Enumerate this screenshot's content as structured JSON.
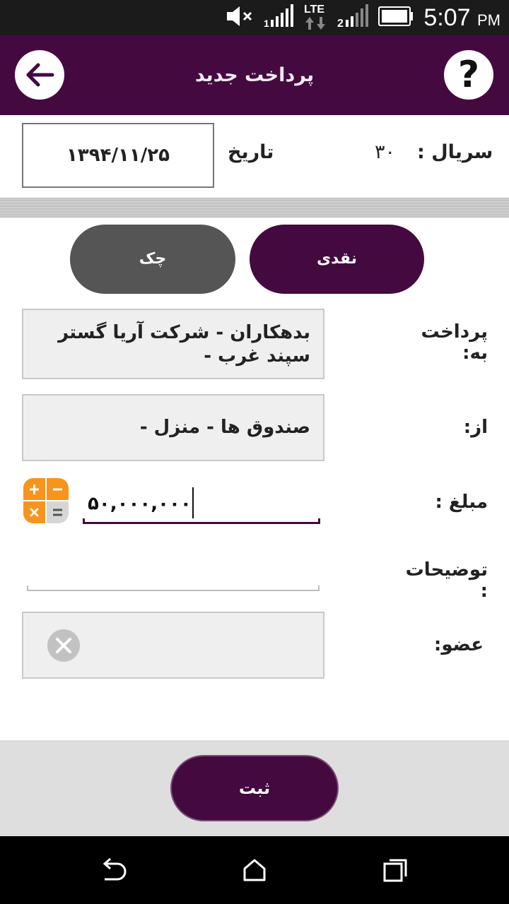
{
  "status_bar": {
    "time": "5:07",
    "ampm": "PM",
    "network": "LTE"
  },
  "app_bar": {
    "title": "پرداخت جدید",
    "help_label": "?"
  },
  "header": {
    "serial_label": "سریال :",
    "serial_value": "۳۰",
    "date_label": "تاریخ",
    "date_value": "۱۳۹۴/۱۱/۲۵"
  },
  "payment_type": {
    "cash_label": "نقدی",
    "cheque_label": "چک",
    "selected": "نقدی"
  },
  "form": {
    "to_label": "پرداخت به:",
    "to_value": "بدهکاران - شرکت آریا گستر سپند غرب -",
    "from_label": "از:",
    "from_value": "صندوق ها - منزل -",
    "amount_label": "مبلغ :",
    "amount_value": "۵۰,۰۰۰,۰۰۰",
    "description_label": "توضیحات :",
    "description_value": "",
    "member_label": "عضو:"
  },
  "actions": {
    "submit_label": "ثبت"
  },
  "colors": {
    "brand": "#440a40",
    "secondary_button": "#555555",
    "status_bar": "#1b1b1b"
  }
}
